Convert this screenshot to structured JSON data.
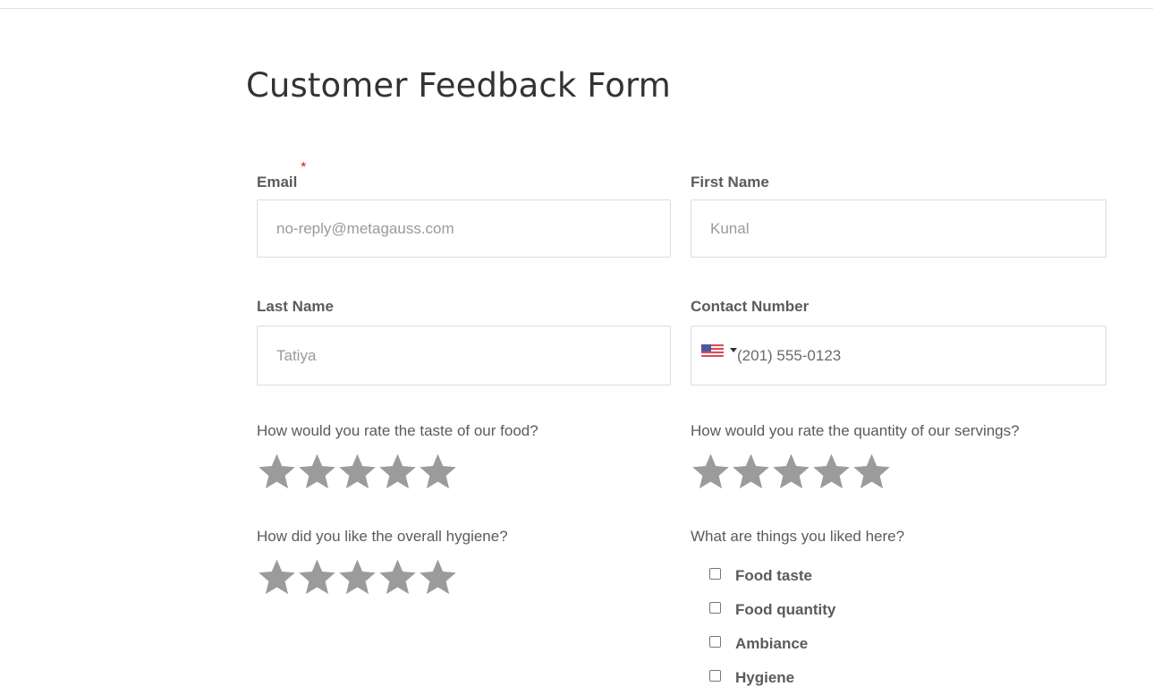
{
  "form": {
    "title": "Customer Feedback Form",
    "required_marker": "*"
  },
  "fields": {
    "email": {
      "label": "Email",
      "placeholder": "no-reply@metagauss.com",
      "value": "",
      "required": true
    },
    "first_name": {
      "label": "First Name",
      "placeholder": "Kunal",
      "value": ""
    },
    "last_name": {
      "label": "Last Name",
      "placeholder": "Tatiya",
      "value": ""
    },
    "contact_number": {
      "label": "Contact Number",
      "country": "US",
      "flag_icon": "us-flag-icon",
      "value": "(201) 555-0123"
    }
  },
  "ratings": [
    {
      "question": "How would you rate the taste of our food?",
      "max": 5,
      "value": 0
    },
    {
      "question": "How would you rate the quantity of our servings?",
      "max": 5,
      "value": 0
    },
    {
      "question": "How did you like the overall hygiene?",
      "max": 5,
      "value": 0
    }
  ],
  "liked": {
    "question": "What are things you liked here?",
    "options": [
      {
        "label": "Food taste",
        "checked": false
      },
      {
        "label": "Food quantity",
        "checked": false
      },
      {
        "label": "Ambiance",
        "checked": false
      },
      {
        "label": "Hygiene",
        "checked": false
      }
    ]
  },
  "colors": {
    "star_empty": "#9b9b9b",
    "required": "#e01111",
    "input_border": "#dcdcdc"
  }
}
